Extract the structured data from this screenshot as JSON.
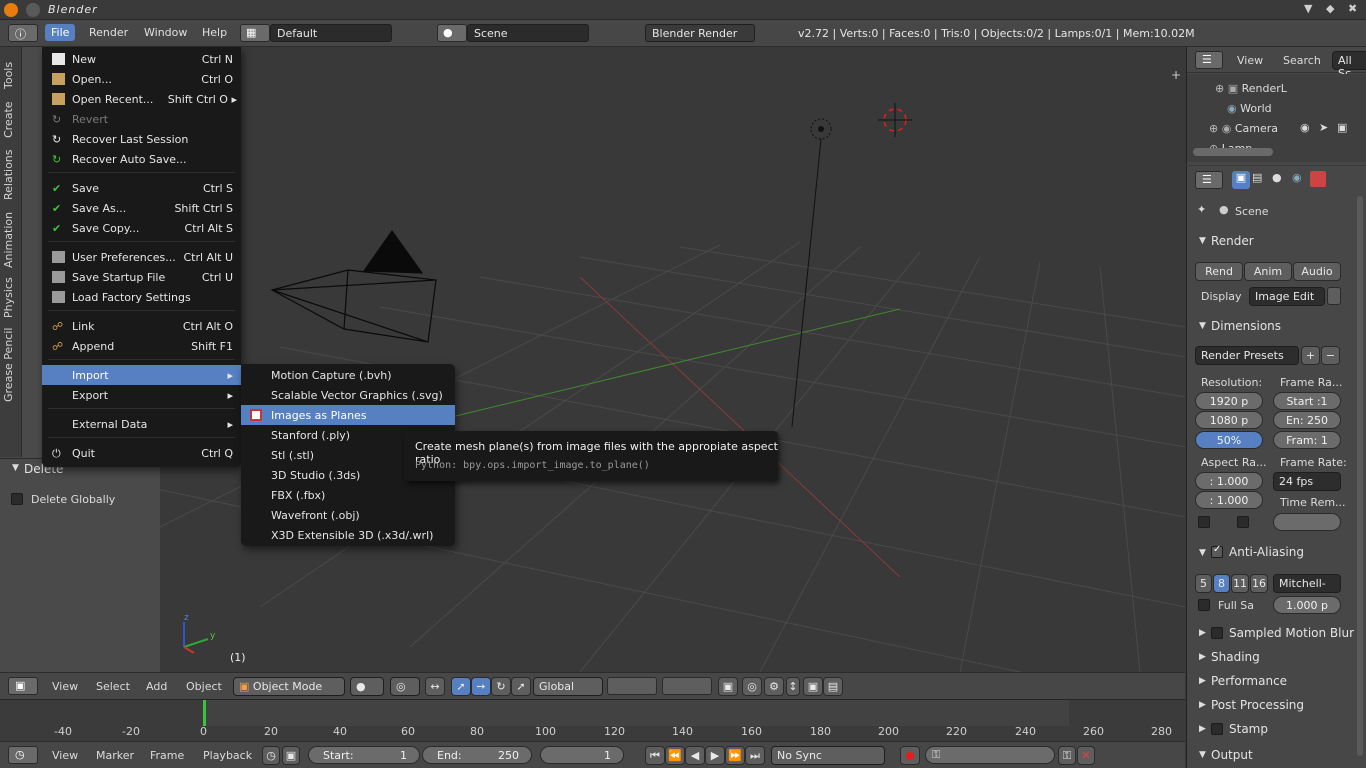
{
  "window": {
    "title": "Blender"
  },
  "header": {
    "menus": [
      "File",
      "Render",
      "Window",
      "Help"
    ],
    "layout": "Default",
    "scene": "Scene",
    "engine": "Blender Render",
    "stats": "v2.72 | Verts:0 | Faces:0 | Tris:0 | Objects:0/2 | Lamps:0/1 | Mem:10.02M"
  },
  "toolshelf": {
    "tabs": [
      "Tools",
      "Create",
      "Relations",
      "Animation",
      "Physics",
      "Grease Pencil"
    ],
    "delete_panel": {
      "title": "Delete",
      "checkbox": "Delete Globally"
    }
  },
  "file_menu": {
    "items": [
      {
        "label": "New",
        "shortcut": "Ctrl N"
      },
      {
        "label": "Open...",
        "shortcut": "Ctrl O"
      },
      {
        "label": "Open Recent...",
        "shortcut": "Shift Ctrl O"
      },
      {
        "label": "Revert",
        "shortcut": ""
      },
      {
        "label": "Recover Last Session",
        "shortcut": ""
      },
      {
        "label": "Recover Auto Save...",
        "shortcut": ""
      },
      {
        "label": "Save",
        "shortcut": "Ctrl S"
      },
      {
        "label": "Save As...",
        "shortcut": "Shift Ctrl S"
      },
      {
        "label": "Save Copy...",
        "shortcut": "Ctrl Alt S"
      },
      {
        "label": "User Preferences...",
        "shortcut": "Ctrl Alt U"
      },
      {
        "label": "Save Startup File",
        "shortcut": "Ctrl U"
      },
      {
        "label": "Load Factory Settings",
        "shortcut": ""
      },
      {
        "label": "Link",
        "shortcut": "Ctrl Alt O"
      },
      {
        "label": "Append",
        "shortcut": "Shift F1"
      },
      {
        "label": "Import",
        "shortcut": ""
      },
      {
        "label": "Export",
        "shortcut": ""
      },
      {
        "label": "External Data",
        "shortcut": ""
      },
      {
        "label": "Quit",
        "shortcut": "Ctrl Q"
      }
    ]
  },
  "import_menu": {
    "items": [
      "Motion Capture (.bvh)",
      "Scalable Vector Graphics (.svg)",
      "Images as Planes",
      "Stanford (.ply)",
      "Stl (.stl)",
      "3D Studio (.3ds)",
      "FBX (.fbx)",
      "Wavefront (.obj)",
      "X3D Extensible 3D (.x3d/.wrl)"
    ]
  },
  "tooltip": {
    "text": "Create mesh plane(s) from image files with the appropiate aspect ratio",
    "python": "Python: bpy.ops.import_image.to_plane()"
  },
  "outliner": {
    "menus": [
      "View",
      "Search",
      "All Sc"
    ],
    "items": [
      "RenderL",
      "World",
      "Camera",
      "Lamp"
    ]
  },
  "properties": {
    "context": "Scene",
    "render_panel": "Render",
    "render_buttons": [
      "Rend",
      "Anim",
      "Audio"
    ],
    "display_label": "Display",
    "display_value": "Image Edit",
    "dimensions_panel": "Dimensions",
    "presets": "Render Presets",
    "resolution_label": "Resolution:",
    "frame_range_label": "Frame Ra...",
    "res_x": "1920 p",
    "res_y": "1080 p",
    "res_pct": "50%",
    "start": "Start :1",
    "end": "En: 250",
    "step": "Fram: 1",
    "aspect_label": "Aspect Ra...",
    "frame_rate_label": "Frame Rate:",
    "aspect_x": ": 1.000",
    "aspect_y": ": 1.000",
    "fps": "24 fps",
    "time_remap": "Time Rem...",
    "aa_panel": "Anti-Aliasing",
    "aa_samples": [
      "5",
      "8",
      "11",
      "16"
    ],
    "aa_filter": "Mitchell-",
    "full_sample": "Full Sa",
    "filter_size": "1.000 p",
    "collapsed_panels": [
      "Sampled Motion Blur",
      "Shading",
      "Performance",
      "Post Processing",
      "Stamp",
      "Output"
    ]
  },
  "viewport": {
    "frame_label": "(1)"
  },
  "view_header": {
    "menus": [
      "View",
      "Select",
      "Add",
      "Object"
    ],
    "mode": "Object Mode",
    "orientation": "Global"
  },
  "timeline": {
    "ticks": [
      "-40",
      "-20",
      "0",
      "20",
      "40",
      "60",
      "80",
      "100",
      "120",
      "140",
      "160",
      "180",
      "200",
      "220",
      "240",
      "260",
      "280"
    ],
    "menus": [
      "View",
      "Marker",
      "Frame",
      "Playback"
    ],
    "start_label": "Start:",
    "start_value": "1",
    "end_label": "End:",
    "end_value": "250",
    "current": "1",
    "sync": "No Sync"
  }
}
